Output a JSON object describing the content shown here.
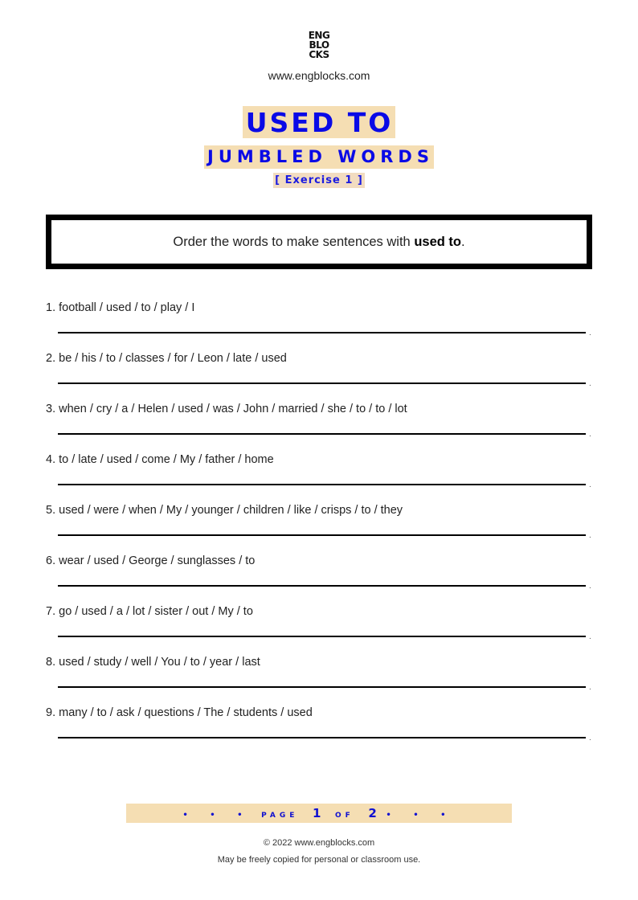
{
  "header": {
    "logo_lines": [
      "ENG",
      "BLO",
      "CKS"
    ],
    "site_url": "www.engblocks.com",
    "title": "USED TO",
    "subtitle": "JUMBLED WORDS",
    "exercise_label": "[ Exercise 1 ]"
  },
  "instructions": {
    "text_before": "Order the words to make sentences with ",
    "bold_text": "used to",
    "text_after": "."
  },
  "items": [
    {
      "number": "1.",
      "words": "football / used / to / play / I"
    },
    {
      "number": "2.",
      "words": "be / his / to / classes / for / Leon / late / used"
    },
    {
      "number": "3.",
      "words": "when / cry / a / Helen / used / was / John / married / she / to / to / lot"
    },
    {
      "number": "4.",
      "words": "to / late / used / come / My / father / home"
    },
    {
      "number": "5.",
      "words": "used / were / when / My / younger / children / like / crisps / to / they"
    },
    {
      "number": "6.",
      "words": "wear / used / George / sunglasses / to"
    },
    {
      "number": "7.",
      "words": "go / used / a / lot / sister / out / My / to"
    },
    {
      "number": "8.",
      "words": "used / study / well / You / to / year / last"
    },
    {
      "number": "9.",
      "words": "many / to / ask / questions / The / students / used"
    }
  ],
  "answer_end_mark": ".",
  "footer": {
    "page_dots": "• • •",
    "page_word": "PAGE",
    "current_page": "1",
    "of_word": "OF",
    "total_pages": "2",
    "copyright": "© 2022 www.engblocks.com",
    "license": "May be freely copied for personal or classroom use."
  },
  "colors": {
    "accent_blue": "#0a0ae6",
    "highlight_tan": "#f5deb3"
  }
}
